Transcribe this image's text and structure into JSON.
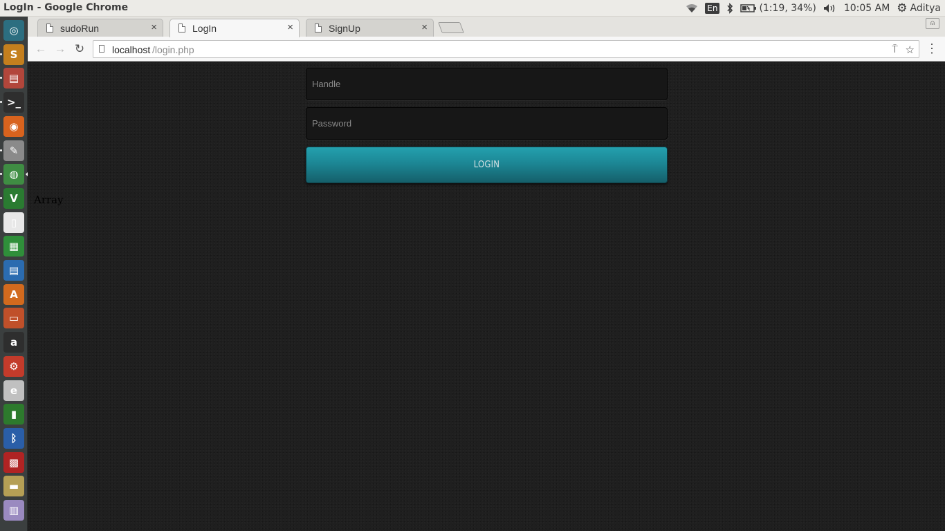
{
  "window": {
    "title": "LogIn - Google Chrome"
  },
  "indicators": {
    "keyboard_layout": "En",
    "battery": "(1:19, 34%)",
    "clock": "10:05 AM",
    "user": "Aditya"
  },
  "launcher": {
    "items": [
      {
        "name": "dash-home-icon",
        "glyph": "◎",
        "color": "#2c6e80"
      },
      {
        "name": "sublime-text-icon",
        "glyph": "S",
        "color": "#c47f1e"
      },
      {
        "name": "file-manager-icon",
        "glyph": "▤",
        "color": "#b2463b"
      },
      {
        "name": "terminal-icon",
        "glyph": ">_",
        "color": "#2e2e2e"
      },
      {
        "name": "firefox-icon",
        "glyph": "◉",
        "color": "#d8631e"
      },
      {
        "name": "text-editor-icon",
        "glyph": "✎",
        "color": "#8a8a8a"
      },
      {
        "name": "chrome-icon",
        "glyph": "◍",
        "color": "#3f8d43"
      },
      {
        "name": "vim-icon",
        "glyph": "V",
        "color": "#2a7b31"
      },
      {
        "name": "libreoffice-icon",
        "glyph": "▯",
        "color": "#e8e8e8"
      },
      {
        "name": "calc-icon",
        "glyph": "▦",
        "color": "#2f8f3a"
      },
      {
        "name": "writer-icon",
        "glyph": "▤",
        "color": "#2b6cb0"
      },
      {
        "name": "software-center-icon",
        "glyph": "A",
        "color": "#d26a1e"
      },
      {
        "name": "impress-icon",
        "glyph": "▭",
        "color": "#c0502a"
      },
      {
        "name": "amazon-icon",
        "glyph": "a",
        "color": "#2e2e2e"
      },
      {
        "name": "system-settings-icon",
        "glyph": "⚙",
        "color": "#c33b2b"
      },
      {
        "name": "debian-icon",
        "glyph": "e",
        "color": "#c0c0c0"
      },
      {
        "name": "battery-app-icon",
        "glyph": "▮",
        "color": "#2d7a2d"
      },
      {
        "name": "bluetooth-app-icon",
        "glyph": "ᛒ",
        "color": "#2a5ea8"
      },
      {
        "name": "workspace-switcher-icon",
        "glyph": "▩",
        "color": "#b02323"
      },
      {
        "name": "drive-icon",
        "glyph": "▬",
        "color": "#b59f55"
      },
      {
        "name": "trash-icon",
        "glyph": "▥",
        "color": "#9a8ac0"
      }
    ]
  },
  "tabs": [
    {
      "label": "sudoRun",
      "close": "×"
    },
    {
      "label": "LogIn",
      "close": "×"
    },
    {
      "label": "SignUp",
      "close": "×"
    }
  ],
  "toolbar": {
    "url_host": "localhost",
    "url_path": "/login.php"
  },
  "page": {
    "handle_placeholder": "Handle",
    "password_placeholder": "Password",
    "login_label": "LOGIN",
    "debug_output": "Array"
  }
}
